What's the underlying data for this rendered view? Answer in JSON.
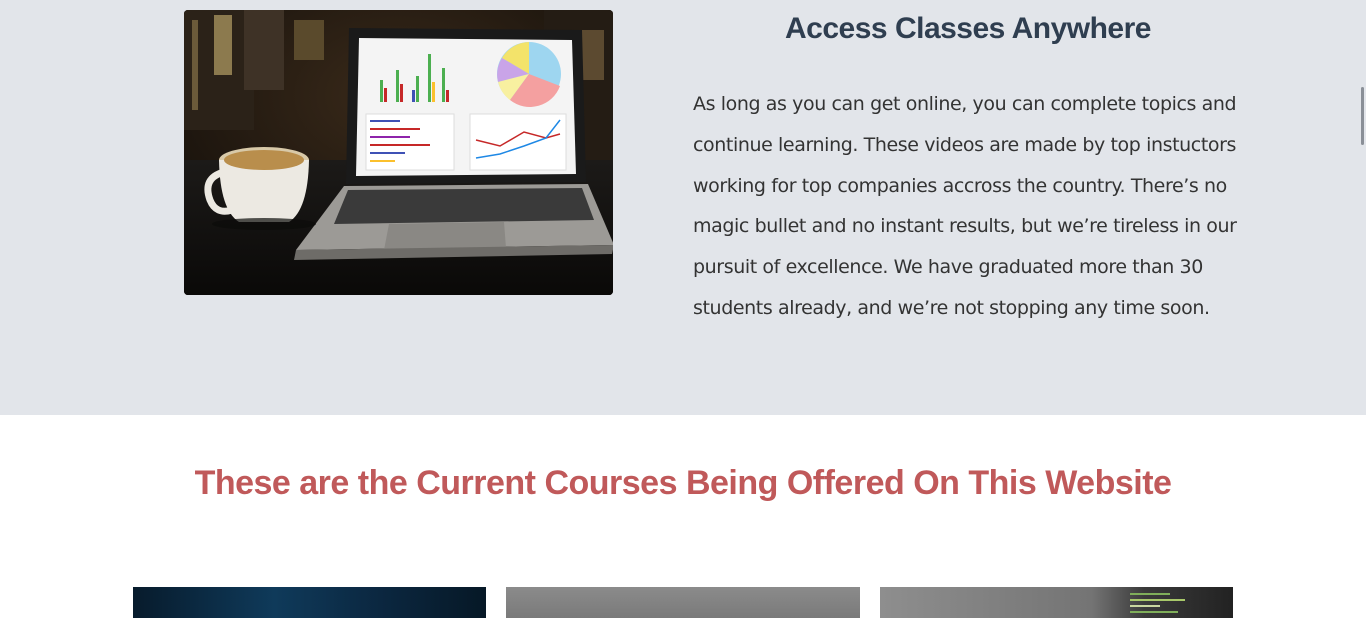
{
  "about": {
    "image_name": "laptop-coffee-photo",
    "heading": "Access Classes Anywhere",
    "paragraph": "As long as you can get online, you can complete topics and continue learning. These videos are made by top instuctors working for top companies accross the country. There’s no magic bullet and no instant results, but we’re tireless in our pursuit of excellence. We have graduated more than 30 students already, and we’re not stopping any time soon."
  },
  "courses": {
    "title": "These are the Current Courses Being Offered On This Website",
    "cards": [
      {
        "image": "course-card-image-1"
      },
      {
        "image": "course-card-image-2"
      },
      {
        "image": "course-card-image-3"
      }
    ]
  },
  "colors": {
    "section_bg": "#e2e5ea",
    "heading": "#2f3e50",
    "courses_title": "#c0595a",
    "body_text": "#333333"
  }
}
